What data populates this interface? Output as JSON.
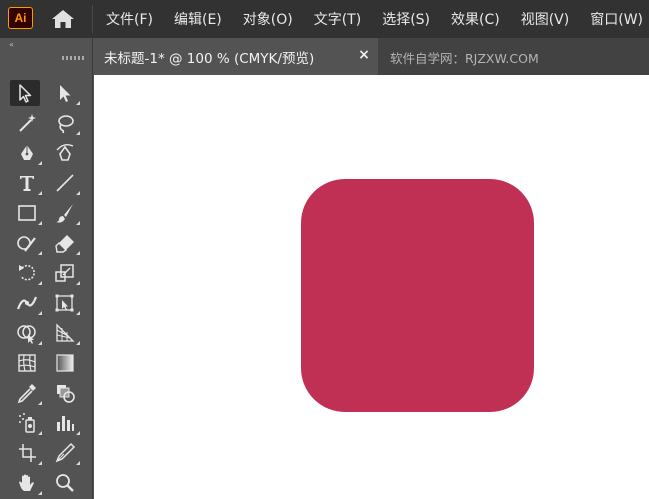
{
  "app": {
    "logo_text": "Ai",
    "logo_color": "#ff9a00",
    "home_icon": "home-icon"
  },
  "menu": {
    "items": [
      "文件(F)",
      "编辑(E)",
      "对象(O)",
      "文字(T)",
      "选择(S)",
      "效果(C)",
      "视图(V)",
      "窗口(W)"
    ]
  },
  "panel": {
    "collapse_label": "«"
  },
  "tools": [
    {
      "name": "selection-tool-icon",
      "active": true
    },
    {
      "name": "direct-selection-tool-icon"
    },
    {
      "name": "magic-wand-tool-icon"
    },
    {
      "name": "lasso-tool-icon"
    },
    {
      "name": "pen-tool-icon"
    },
    {
      "name": "curvature-tool-icon"
    },
    {
      "name": "type-tool-icon"
    },
    {
      "name": "line-segment-tool-icon"
    },
    {
      "name": "rectangle-tool-icon"
    },
    {
      "name": "paintbrush-tool-icon"
    },
    {
      "name": "shaper-tool-icon"
    },
    {
      "name": "eraser-tool-icon"
    },
    {
      "name": "rotate-tool-icon"
    },
    {
      "name": "scale-tool-icon"
    },
    {
      "name": "width-tool-icon"
    },
    {
      "name": "free-transform-tool-icon"
    },
    {
      "name": "shape-builder-tool-icon"
    },
    {
      "name": "perspective-grid-tool-icon"
    },
    {
      "name": "mesh-tool-icon"
    },
    {
      "name": "gradient-tool-icon"
    },
    {
      "name": "eyedropper-tool-icon"
    },
    {
      "name": "blend-tool-icon"
    },
    {
      "name": "symbol-sprayer-tool-icon"
    },
    {
      "name": "column-graph-tool-icon"
    },
    {
      "name": "artboard-tool-icon"
    },
    {
      "name": "slice-tool-icon"
    },
    {
      "name": "hand-tool-icon"
    },
    {
      "name": "zoom-tool-icon"
    }
  ],
  "tabs": {
    "active_title": "未标题-1* @ 100 % (CMYK/预览)",
    "close_label": "×",
    "inactive_title": "软件自学网：RJZXW.COM"
  },
  "canvas": {
    "background": "#ffffff",
    "shape_color": "#c03055"
  }
}
